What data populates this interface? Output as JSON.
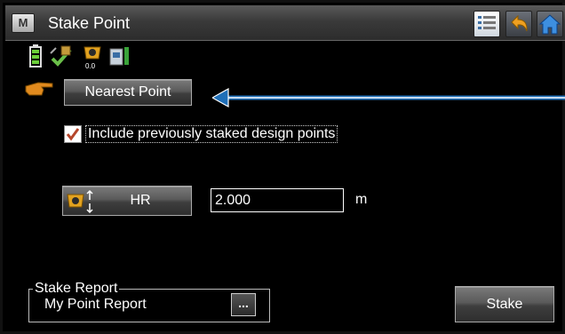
{
  "window": {
    "menu_label": "M",
    "title": "Stake Point"
  },
  "toolbar": {
    "list_icon": "list-icon",
    "back_icon": "back-arrow-icon",
    "home_icon": "home-icon"
  },
  "status": {
    "icons": [
      "battery-icon",
      "satellite-fix-icon",
      "total-station-icon",
      "controller-memory-icon"
    ],
    "station_value": "0.0"
  },
  "nearest_point": {
    "label": "Nearest Point"
  },
  "include_staked": {
    "label": "Include previously staked design points",
    "checked": true
  },
  "hr": {
    "label": "HR",
    "value": "2.000",
    "unit": "m"
  },
  "stake_report": {
    "legend": "Stake Report",
    "value": "My Point Report",
    "browse_label": "..."
  },
  "stake_button": {
    "label": "Stake"
  },
  "colors": {
    "accent_arrow": "#1f6fb8",
    "pointer": "#e08a1e",
    "check_mark": "#b5462b"
  }
}
